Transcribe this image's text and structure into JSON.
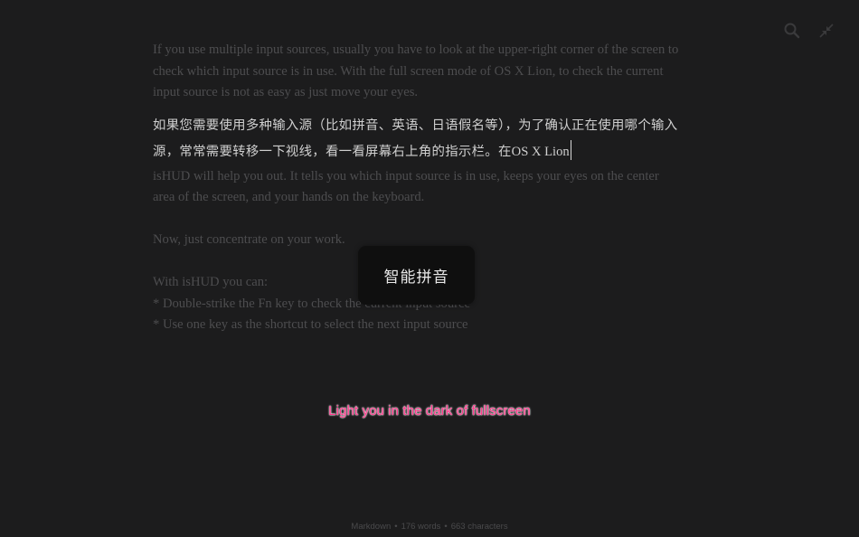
{
  "toolbar": {
    "search_icon": "search-icon",
    "exit_fullscreen_icon": "exit-fullscreen-icon"
  },
  "document": {
    "para1_line1": "If you use multiple input sources, usually you have to look at the upper-right corner of the screen to",
    "para1_line2": "check which input source is in use. With the full screen mode of OS X Lion, to check the current",
    "para1_line3": "input source is not as easy as just move your eyes.",
    "active_line1": "如果您需要使用多种输入源（比如拼音、英语、日语假名等），为了确认正在使用哪个输入",
    "active_line2_cjk": "源，常常需要转移一下视线，看一看屏幕右上角的指示栏。在",
    "active_line2_latin": "OS X Lion",
    "para2_line1": "isHUD will help you out. It tells you which input source is in use, keeps your eyes on the center",
    "para2_line2": "area of the screen, and your hands on the keyboard.",
    "para3": "Now, just concentrate on your work.",
    "list_heading": "With isHUD you can:",
    "list_item1": "* Double-strike the Fn key to check the current input source",
    "list_item2": "* Use one key as the shortcut to select the next input source"
  },
  "hud": {
    "input_source": "智能拼音"
  },
  "tagline": "Light you in the dark of fullscreen",
  "status": {
    "mode": "Markdown",
    "words": "176 words",
    "characters": "663 characters",
    "separator": "•"
  },
  "colors": {
    "background": "#1c1c1d",
    "dim_text": "#4d4d4f",
    "active_text": "#cfcfcf",
    "tagline": "#ff3a8c"
  }
}
